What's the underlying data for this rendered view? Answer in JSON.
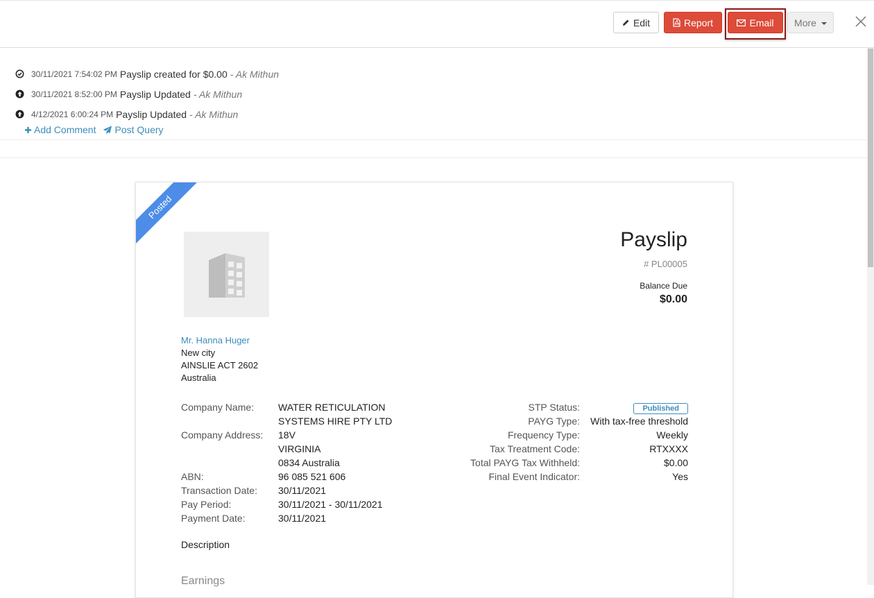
{
  "toolbar": {
    "edit_label": "Edit",
    "report_label": "Report",
    "email_label": "Email",
    "more_label": "More"
  },
  "activity": [
    {
      "time": "30/11/2021 7:54:02 PM",
      "message": "Payslip created for $0.00",
      "user": "- Ak Mithun",
      "icon": "check-circle-icon"
    },
    {
      "time": "30/11/2021 8:52:00 PM",
      "message": "Payslip Updated",
      "user": "- Ak Mithun",
      "icon": "arrow-up-circle-icon"
    },
    {
      "time": "4/12/2021 6:00:24 PM",
      "message": "Payslip Updated",
      "user": "- Ak Mithun",
      "icon": "arrow-up-circle-icon"
    }
  ],
  "actions": {
    "add_comment": "Add Comment",
    "post_query": "Post Query"
  },
  "document": {
    "ribbon": "Posted",
    "title": "Payslip",
    "number": "# PL00005",
    "balance_label": "Balance Due",
    "balance_value": "$0.00",
    "address": {
      "name": "Mr. Hanna Huger",
      "line1": "New city",
      "line2": "AINSLIE ACT 2602",
      "line3": "Australia"
    },
    "left_info": {
      "company_name_label": "Company Name:",
      "company_name_1": "WATER RETICULATION",
      "company_name_2": "SYSTEMS HIRE PTY LTD",
      "company_address_label": "Company Address:",
      "address_1": "18V",
      "address_2": "VIRGINIA",
      "address_3": "0834 Australia",
      "abn_label": "ABN:",
      "abn": "96 085 521 606",
      "transaction_date_label": "Transaction Date:",
      "transaction_date": "30/11/2021",
      "pay_period_label": "Pay Period:",
      "pay_period": "30/11/2021 - 30/11/2021",
      "payment_date_label": "Payment Date:",
      "payment_date": "30/11/2021"
    },
    "right_info": {
      "stp_status_label": "STP Status:",
      "stp_status": "Published",
      "payg_type_label": "PAYG Type:",
      "payg_type": "With tax-free threshold",
      "frequency_label": "Frequency Type:",
      "frequency": "Weekly",
      "tax_code_label": "Tax Treatment Code:",
      "tax_code": "RTXXXX",
      "total_payg_label": "Total PAYG Tax Withheld:",
      "total_payg": "$0.00",
      "final_event_label": "Final Event Indicator:",
      "final_event": "Yes"
    },
    "description_label": "Description",
    "earnings_label": "Earnings"
  }
}
